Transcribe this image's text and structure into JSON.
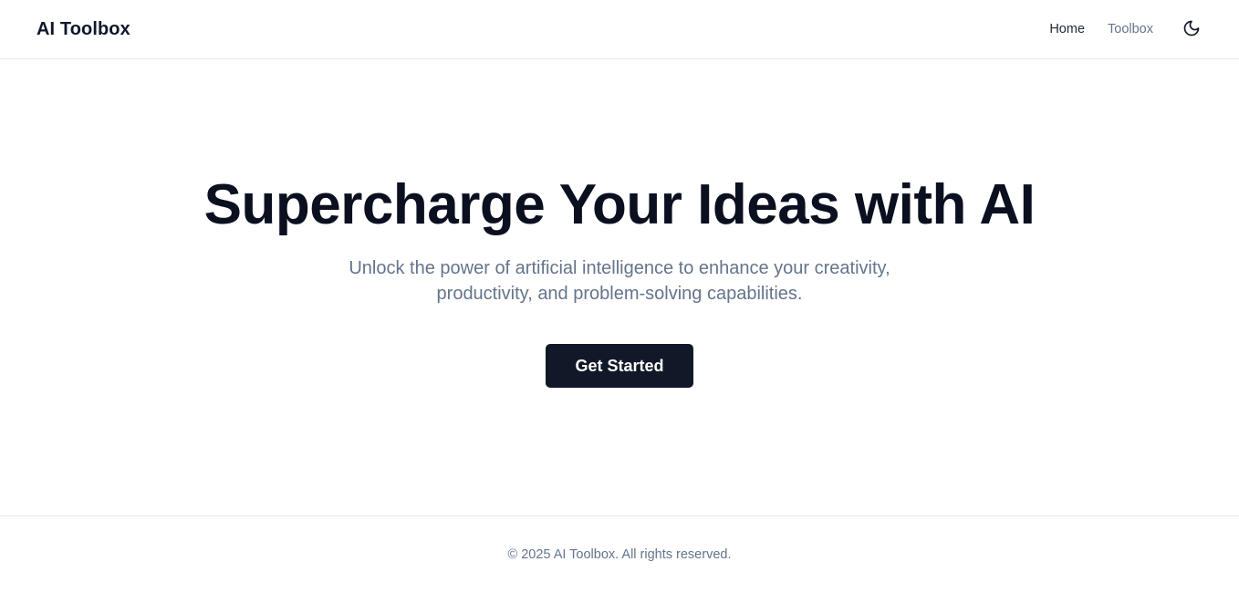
{
  "header": {
    "brand": "AI Toolbox",
    "nav": {
      "home": "Home",
      "toolbox": "Toolbox"
    },
    "theme_toggle_icon": "moon-icon"
  },
  "hero": {
    "title": "Supercharge Your Ideas with AI",
    "subtitle": "Unlock the power of artificial intelligence to enhance your creativity, productivity, and problem-solving capabilities.",
    "cta_label": "Get Started"
  },
  "footer": {
    "copyright": "© 2025 AI Toolbox. All rights reserved."
  },
  "colors": {
    "primary_button": "#111827",
    "muted_text": "#64748b",
    "heading": "#0b1020",
    "border": "#e5e7eb"
  }
}
